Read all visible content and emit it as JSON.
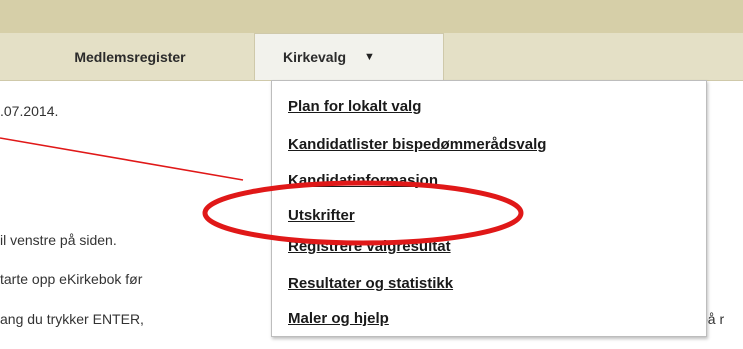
{
  "nav": {
    "tabs": [
      {
        "label": "Medlemsregister"
      },
      {
        "label": "Kirkevalg"
      }
    ]
  },
  "content": {
    "lines": [
      ".07.2014.",
      "il venstre på siden.",
      "tarte opp eKirkebok før",
      "ang du trykker ENTER,",
      "på r"
    ]
  },
  "dropdown": {
    "items": [
      "Plan for lokalt valg",
      "Kandidatlister bispedømmerådsvalg",
      "Kandidatinformasjon",
      "Utskrifter",
      "Registrere valgresultat",
      "Resultater og statistikk",
      "Maler og hjelp"
    ]
  },
  "colors": {
    "topbar": "#d6cfa8",
    "navbar": "#e4e0c6",
    "annotation": "#e01818"
  }
}
